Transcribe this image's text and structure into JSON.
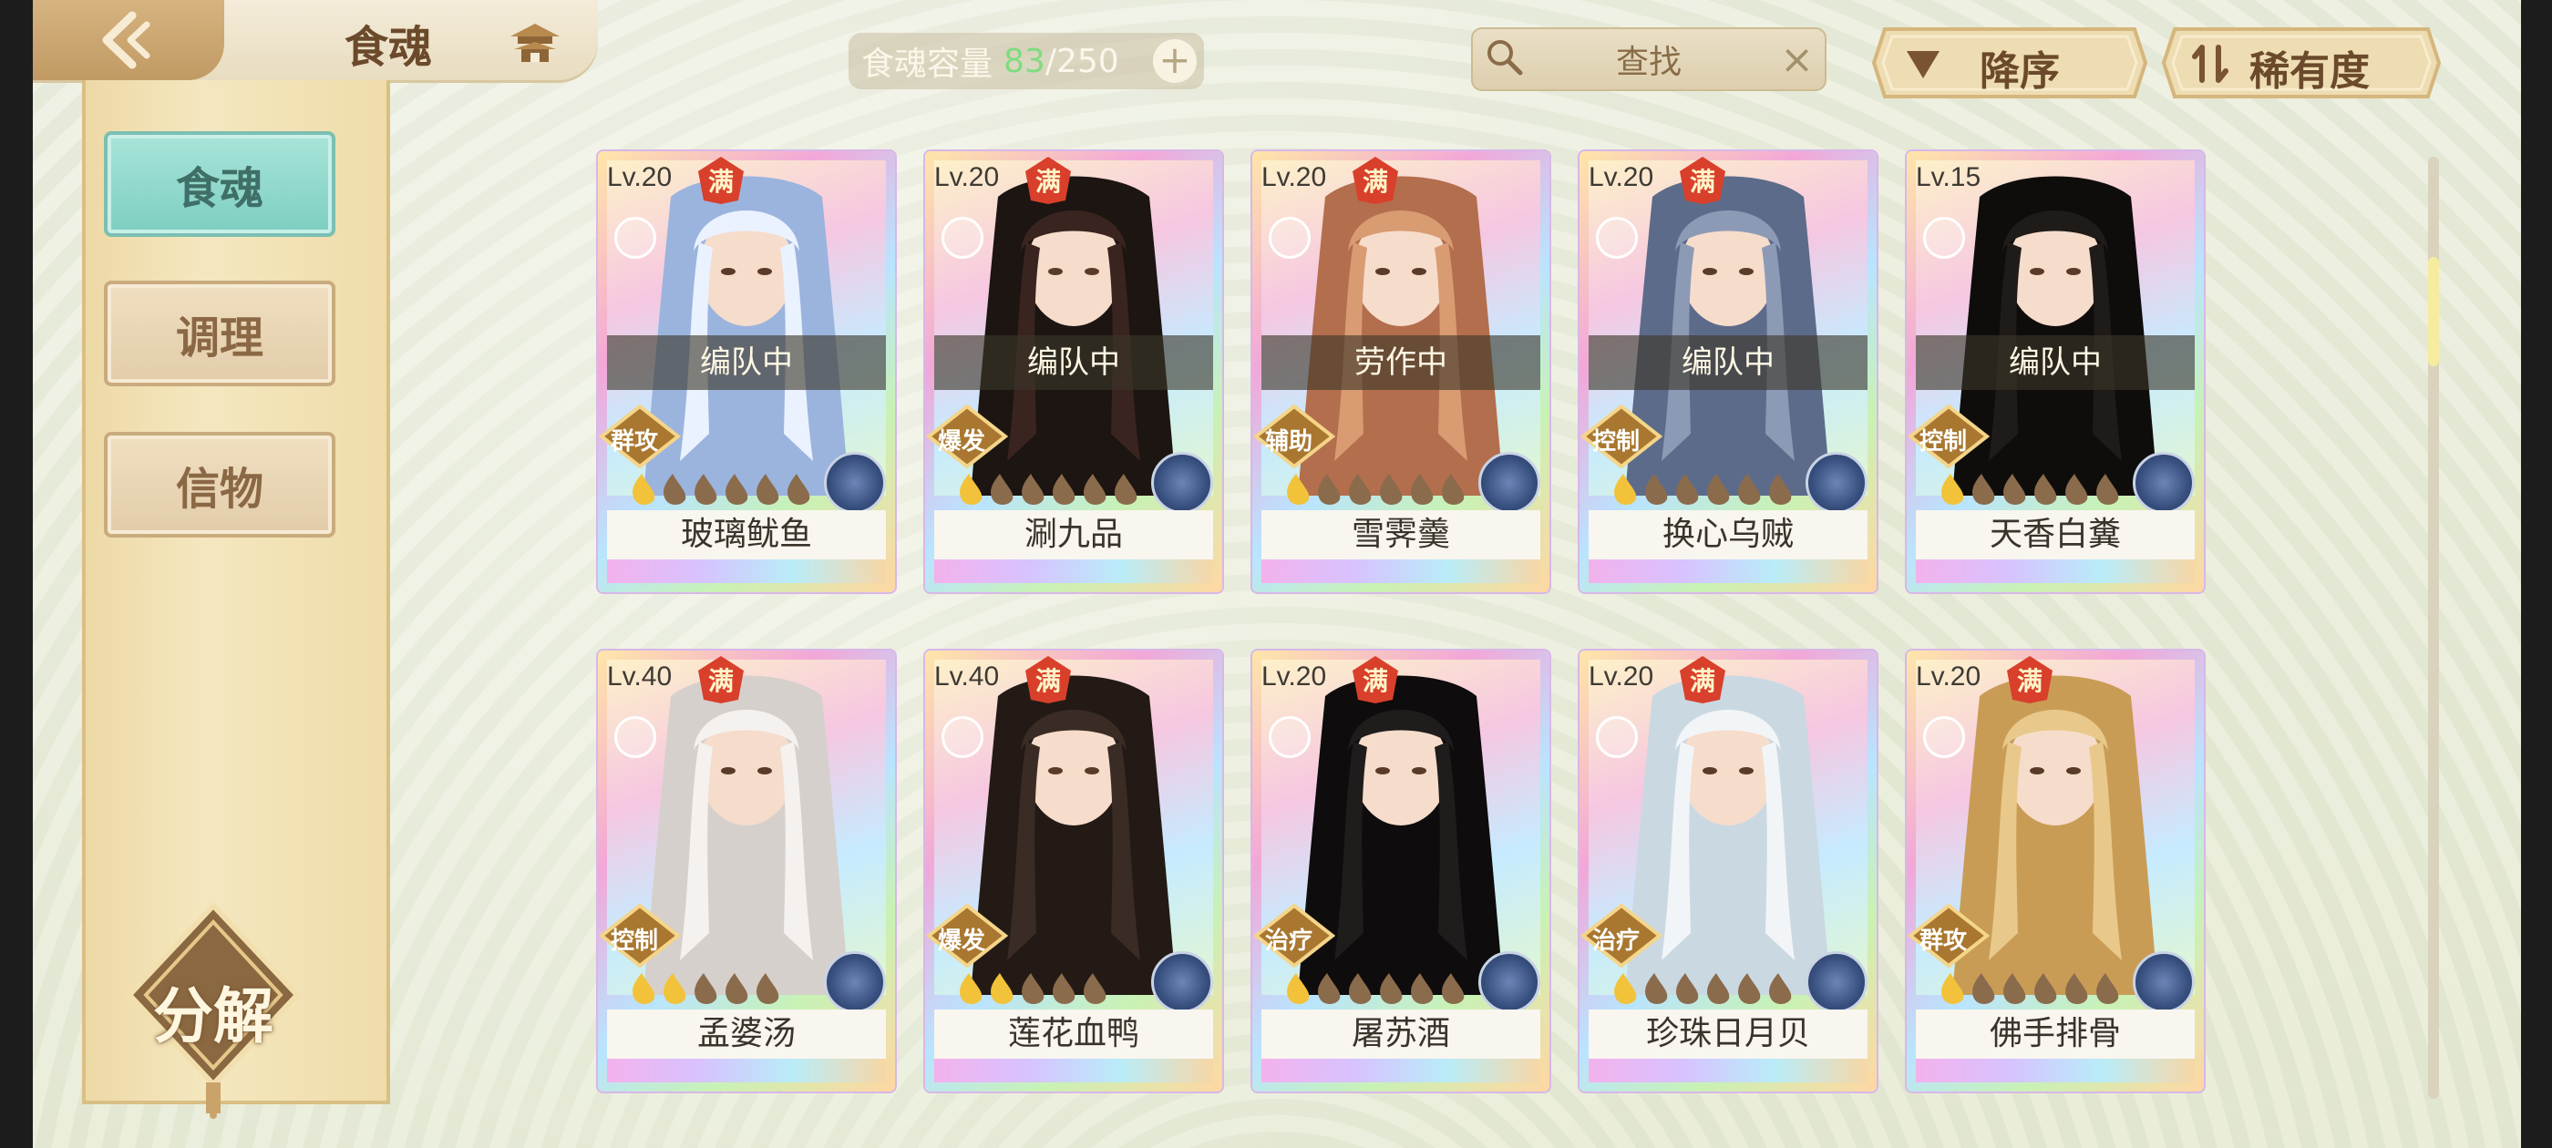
{
  "header": {
    "title": "食魂",
    "capacity_label": "食魂容量",
    "capacity_count": "83",
    "capacity_max": "/250",
    "capacity_plus": "+",
    "search_placeholder": "查找",
    "search_clear": "×",
    "sort_order_label": "降序",
    "sort_rarity_label": "稀有度",
    "back_icon": "back-arrow-icon",
    "home_icon": "pagoda-home-icon"
  },
  "sidebar": {
    "tabs": [
      {
        "label": "食魂",
        "active": true
      },
      {
        "label": "调理",
        "active": false
      },
      {
        "label": "信物",
        "active": false
      }
    ],
    "decompose_label": "分解"
  },
  "colors": {
    "accent_teal": "#7ccfc0",
    "capacity_green": "#7fdc7f",
    "max_badge_red": "#d8402b",
    "role_badge_gold": "#a9772f",
    "star_gold": "#f2c33a",
    "star_brown": "#8a6b4c"
  },
  "cards": [
    {
      "level": "Lv.20",
      "max": "满",
      "status": "编队中",
      "role": "群攻",
      "stars_filled": 1,
      "stars_total": 6,
      "name": "玻璃鱿鱼",
      "palette": [
        "#eaf2ff",
        "#9bb4de",
        "#3d5aa6"
      ]
    },
    {
      "level": "Lv.20",
      "max": "满",
      "status": "编队中",
      "role": "爆发",
      "stars_filled": 1,
      "stars_total": 6,
      "name": "涮九品",
      "palette": [
        "#3a2420",
        "#1c1512",
        "#c8362e"
      ]
    },
    {
      "level": "Lv.20",
      "max": "满",
      "status": "劳作中",
      "role": "辅助",
      "stars_filled": 1,
      "stars_total": 6,
      "name": "雪霁羹",
      "palette": [
        "#d99b72",
        "#b36e4d",
        "#f3e6dd"
      ]
    },
    {
      "level": "Lv.20",
      "max": "满",
      "status": "编队中",
      "role": "控制",
      "stars_filled": 1,
      "stars_total": 6,
      "name": "换心乌贼",
      "palette": [
        "#8d9ab6",
        "#5d6b8a",
        "#e8eef8"
      ]
    },
    {
      "level": "Lv.15",
      "max": "",
      "status": "编队中",
      "role": "控制",
      "stars_filled": 1,
      "stars_total": 6,
      "name": "天香白糞",
      "palette": [
        "#1f1b19",
        "#0f0d0c",
        "#f1eadb"
      ]
    },
    {
      "level": "Lv.40",
      "max": "满",
      "status": "",
      "role": "控制",
      "stars_filled": 2,
      "stars_total": 5,
      "name": "孟婆汤",
      "palette": [
        "#f4f1ef",
        "#d6d0cc",
        "#c0283a"
      ]
    },
    {
      "level": "Lv.40",
      "max": "满",
      "status": "",
      "role": "爆发",
      "stars_filled": 2,
      "stars_total": 5,
      "name": "莲花血鸭",
      "palette": [
        "#3a2c25",
        "#231a15",
        "#d1562b"
      ]
    },
    {
      "level": "Lv.20",
      "max": "满",
      "status": "",
      "role": "治疗",
      "stars_filled": 1,
      "stars_total": 6,
      "name": "屠苏酒",
      "palette": [
        "#1f1c1c",
        "#0e0c0c",
        "#c7393a"
      ]
    },
    {
      "level": "Lv.20",
      "max": "满",
      "status": "",
      "role": "治疗",
      "stars_filled": 1,
      "stars_total": 6,
      "name": "珍珠日月贝",
      "palette": [
        "#f2f5f7",
        "#cad8e2",
        "#d6b25a"
      ]
    },
    {
      "level": "Lv.20",
      "max": "满",
      "status": "",
      "role": "群攻",
      "stars_filled": 1,
      "stars_total": 6,
      "name": "佛手排骨",
      "palette": [
        "#e8c98b",
        "#c99c56",
        "#2f6d5a"
      ]
    }
  ],
  "scrollbar": {
    "position_fraction": 0.12
  }
}
